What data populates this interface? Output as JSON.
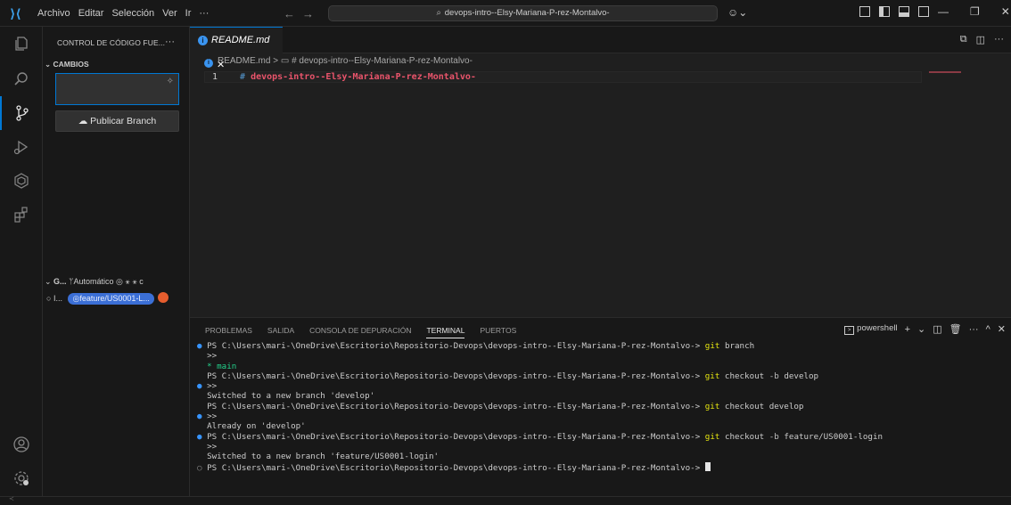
{
  "titlebar": {
    "menus": [
      "Archivo",
      "Editar",
      "Selección",
      "Ver",
      "Ir",
      "···"
    ],
    "command_center": "devops-intro--Elsy-Mariana-P-rez-Montalvo-",
    "nav_back": "←",
    "nav_forward": "→",
    "copilot_label": "⌄",
    "win_minimize": "—",
    "win_restore": "❐",
    "win_close": "✕"
  },
  "sidebar": {
    "title": "CONTROL DE CÓDIGO FUE...",
    "more": "···",
    "section_changes": "CAMBIOS",
    "publish_button": "Publicar Branch",
    "graph_header_prefix": "G...",
    "graph_mode": "Automático",
    "graph_row_label": "I...",
    "graph_branch": "feature/US0001-L..."
  },
  "editor": {
    "tab_label": "README.md",
    "tab_close": "✕",
    "breadcrumb_file": "README.md",
    "breadcrumb_sep": ">",
    "breadcrumb_symbol": "# devops-intro--Elsy-Mariana-P-rez-Montalvo-",
    "line_number": "1",
    "code_hash": "#",
    "code_text": "devops-intro--Elsy-Mariana-P-rez-Montalvo-"
  },
  "panel": {
    "tabs": [
      "PROBLEMAS",
      "SALIDA",
      "CONSOLA DE DEPURACIÓN",
      "TERMINAL",
      "PUERTOS"
    ],
    "active_tab": "TERMINAL",
    "shell": "powershell",
    "prompt": "PS C:\\Users\\mari-\\OneDrive\\Escritorio\\Repositorio-Devops\\devops-intro--Elsy-Mariana-P-rez-Montalvo->",
    "cmd1_git": "git",
    "cmd1_rest": "branch",
    "cont": ">>",
    "branch_list": "* main",
    "cmd2_git": "git",
    "cmd2_a": "checkout",
    "cmd2_flag": "-b",
    "cmd2_b": "develop",
    "out2": "Switched to a new branch 'develop'",
    "cmd3_git": "git",
    "cmd3_rest": "checkout develop",
    "out3": "Already on 'develop'",
    "cmd4_git": "git",
    "cmd4_a": "checkout",
    "cmd4_flag": "-b",
    "cmd4_b": "feature/US0001-login",
    "out4": "Switched to a new branch 'feature/US0001-login'"
  }
}
